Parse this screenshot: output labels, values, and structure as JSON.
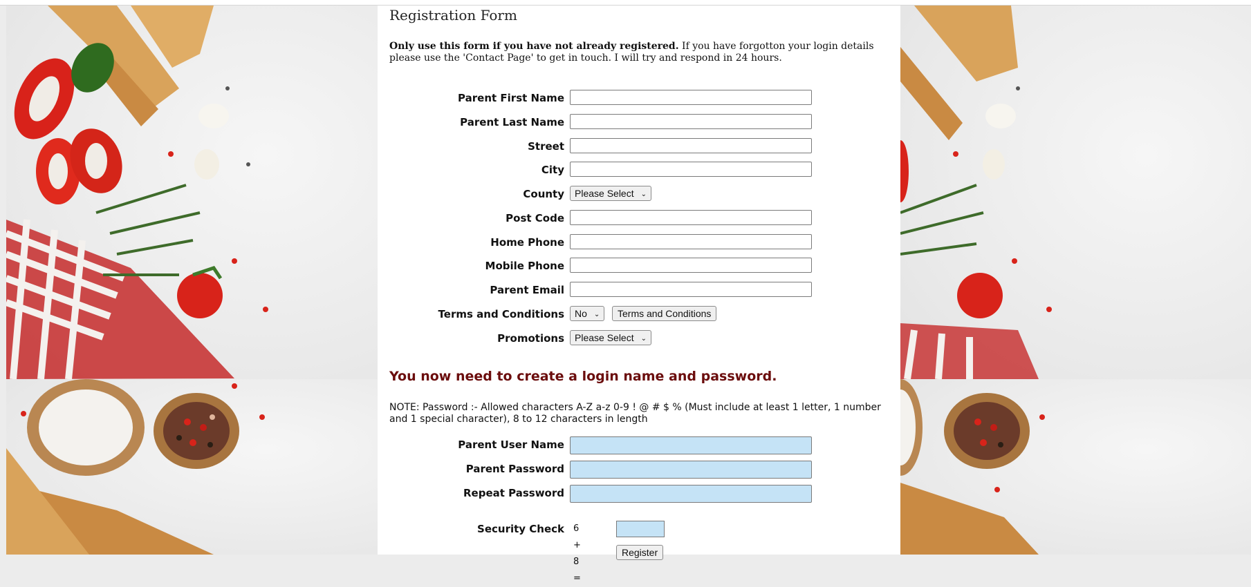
{
  "form": {
    "title": "Registration Form",
    "intro_bold": "Only use this form if you have not already registered.",
    "intro_rest": " If you have forgotton your login details please use the 'Contact Page' to get in touch. I will try and respond in 24 hours.",
    "labels": {
      "first_name": "Parent First Name",
      "last_name": "Parent Last Name",
      "street": "Street",
      "city": "City",
      "county": "County",
      "post_code": "Post Code",
      "home_phone": "Home Phone",
      "mobile_phone": "Mobile Phone",
      "email": "Parent Email",
      "terms": "Terms and Conditions",
      "promotions": "Promotions"
    },
    "county_selected": "Please Select",
    "terms_selected": "No",
    "terms_button": "Terms and Conditions",
    "promotions_selected": "Please Select"
  },
  "login": {
    "heading": "You now need to create a login name and password.",
    "note": "NOTE: Password :- Allowed characters A-Z a-z 0-9 ! @ # $ % (Must include at least 1 letter, 1 number and 1 special character), 8 to 12 characters in length",
    "labels": {
      "user_name": "Parent User Name",
      "password": "Parent Password",
      "repeat_password": "Repeat Password",
      "security_check": "Security Check"
    },
    "security_question": "6 + 8 =",
    "register_button": "Register"
  },
  "icons": {
    "select_chevron": "chevron-down-icon"
  },
  "colors": {
    "login_heading": "#6b0d0d",
    "login_input_bg": "#c5e3f6",
    "panel_bg": "#ffffff"
  }
}
